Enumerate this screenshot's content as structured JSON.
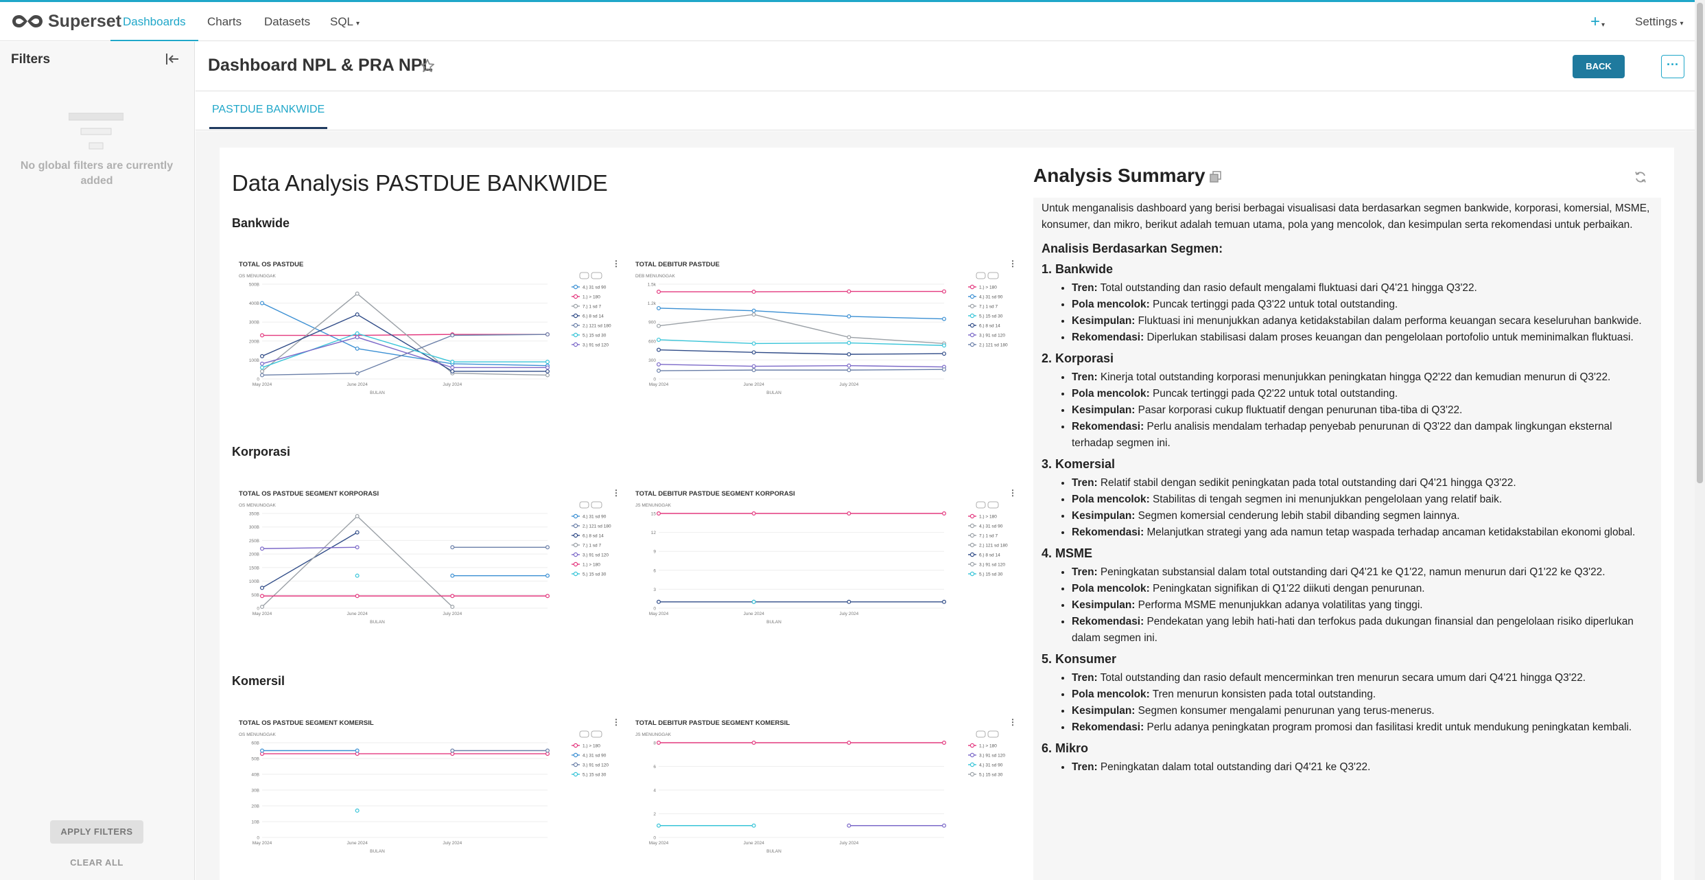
{
  "app": {
    "brand": "Superset"
  },
  "nav": {
    "items": [
      {
        "label": "Dashboards",
        "active": true
      },
      {
        "label": "Charts"
      },
      {
        "label": "Datasets"
      },
      {
        "label": "SQL"
      }
    ],
    "plus": "+",
    "settings": "Settings"
  },
  "sidebar": {
    "title": "Filters",
    "empty_text": "No global filters are currently added",
    "apply_label": "APPLY FILTERS",
    "clear_label": "CLEAR ALL"
  },
  "dashboard": {
    "title": "Dashboard NPL & PRA NPL",
    "back_label": "BACK",
    "more_label": "···",
    "tab": "PASTDUE BANKWIDE",
    "heading": "Data Analysis PASTDUE BANKWIDE",
    "sections": [
      "Bankwide",
      "Korporasi",
      "Komersil"
    ]
  },
  "colors": {
    "accent": "#20a7c9",
    "pink": "#e3387e",
    "navy": "#2f4b87",
    "teal": "#37c4d8",
    "grey": "#9aa0a6",
    "blue": "#3a8fd3",
    "purple": "#7b68c8"
  },
  "chart_data": [
    {
      "title": "TOTAL OS PASTDUE",
      "type": "line",
      "ylabel": "OS MENUNGGAK",
      "xlabel": "BULAN",
      "x": [
        "May 2024",
        "June 2024",
        "July 2024",
        ""
      ],
      "yticks": [
        "0",
        "100B",
        "200B",
        "300B",
        "400B",
        "500B"
      ],
      "ylim": [
        0,
        500
      ],
      "legend": [
        "4.) 31 sd 90",
        "1.) > 180",
        "7.) 1 sd 7",
        "6.) 8 sd 14",
        "2.) 121 sd 180",
        "5.) 15 sd 30",
        "3.) 91 sd 120"
      ],
      "series": [
        {
          "name": "4.) 31 sd 90",
          "color": "#3a8fd3",
          "values": [
            400,
            160,
            80,
            70
          ]
        },
        {
          "name": "1.) > 180",
          "color": "#e3387e",
          "values": [
            230,
            230,
            235,
            235
          ]
        },
        {
          "name": "7.) 1 sd 7",
          "color": "#9aa0a6",
          "values": [
            40,
            450,
            30,
            20
          ]
        },
        {
          "name": "6.) 8 sd 14",
          "color": "#2f4b87",
          "values": [
            120,
            340,
            40,
            40
          ]
        },
        {
          "name": "2.) 121 sd 180",
          "color": "#6a7fa8",
          "values": [
            20,
            30,
            230,
            235
          ]
        },
        {
          "name": "5.) 15 sd 30",
          "color": "#37c4d8",
          "values": [
            60,
            240,
            90,
            90
          ]
        },
        {
          "name": "3.) 91 sd 120",
          "color": "#7b68c8",
          "values": [
            80,
            220,
            60,
            60
          ]
        }
      ]
    },
    {
      "title": "TOTAL DEBITUR PASTDUE",
      "type": "line",
      "ylabel": "DEB MENUNGGAK",
      "xlabel": "BULAN",
      "x": [
        "May 2024",
        "June 2024",
        "July 2024",
        ""
      ],
      "yticks": [
        "0",
        "300",
        "600",
        "900",
        "1.2k",
        "1.5k"
      ],
      "ylim": [
        0,
        1500
      ],
      "legend": [
        "1.) > 180",
        "4.) 31 sd 90",
        "7.) 1 sd 7",
        "5.) 15 sd 30",
        "6.) 8 sd 14",
        "3.) 91 sd 120",
        "2.) 121 sd 180"
      ],
      "series": [
        {
          "name": "1.) > 180",
          "color": "#e3387e",
          "values": [
            1380,
            1380,
            1385,
            1385
          ]
        },
        {
          "name": "4.) 31 sd 90",
          "color": "#3a8fd3",
          "values": [
            1120,
            1080,
            990,
            950
          ]
        },
        {
          "name": "7.) 1 sd 7",
          "color": "#9aa0a6",
          "values": [
            840,
            1020,
            660,
            560
          ]
        },
        {
          "name": "5.) 15 sd 30",
          "color": "#37c4d8",
          "values": [
            620,
            560,
            570,
            530
          ]
        },
        {
          "name": "6.) 8 sd 14",
          "color": "#2f4b87",
          "values": [
            460,
            420,
            390,
            400
          ]
        },
        {
          "name": "3.) 91 sd 120",
          "color": "#7b68c8",
          "values": [
            230,
            200,
            210,
            190
          ]
        },
        {
          "name": "2.) 121 sd 180",
          "color": "#6a7fa8",
          "values": [
            130,
            140,
            140,
            150
          ]
        }
      ]
    },
    {
      "title": "TOTAL OS PASTDUE SEGMENT KORPORASI",
      "type": "line",
      "ylabel": "OS MENUNGGAK",
      "xlabel": "BULAN",
      "x": [
        "May 2024",
        "June 2024",
        "July 2024",
        ""
      ],
      "yticks": [
        "0",
        "50B",
        "100B",
        "150B",
        "200B",
        "250B",
        "300B",
        "350B"
      ],
      "ylim": [
        0,
        350
      ],
      "legend": [
        "4.) 31 sd 90",
        "2.) 121 sd 180",
        "6.) 8 sd 14",
        "7.) 1 sd 7",
        "3.) 91 sd 120",
        "1.) > 180",
        "5.) 15 sd 30"
      ],
      "series": [
        {
          "name": "4.) 31 sd 90",
          "color": "#3a8fd3",
          "values": [
            null,
            null,
            120,
            120
          ]
        },
        {
          "name": "2.) 121 sd 180",
          "color": "#6a7fa8",
          "values": [
            null,
            null,
            225,
            225
          ]
        },
        {
          "name": "6.) 8 sd 14",
          "color": "#2f4b87",
          "values": [
            75,
            280,
            null,
            null
          ]
        },
        {
          "name": "7.) 1 sd 7",
          "color": "#9aa0a6",
          "values": [
            5,
            340,
            5,
            null
          ]
        },
        {
          "name": "3.) 91 sd 120",
          "color": "#7b68c8",
          "values": [
            220,
            225,
            null,
            null
          ]
        },
        {
          "name": "1.) > 180",
          "color": "#e3387e",
          "values": [
            45,
            45,
            45,
            45
          ]
        },
        {
          "name": "5.) 15 sd 30",
          "color": "#37c4d8",
          "values": [
            null,
            120,
            null,
            null
          ]
        }
      ]
    },
    {
      "title": "TOTAL DEBITUR PASTDUE SEGMENT KORPORASI",
      "type": "line",
      "ylabel": "JS MENUNGGAK",
      "xlabel": "BULAN",
      "x": [
        "May 2024",
        "June 2024",
        "July 2024",
        ""
      ],
      "yticks": [
        "0",
        "3",
        "6",
        "9",
        "12",
        "15"
      ],
      "ylim": [
        0,
        15
      ],
      "legend": [
        "1.) > 180",
        "4.) 31 sd 90",
        "7.) 1 sd 7",
        "2.) 121 sd 180",
        "6.) 8 sd 14",
        "3.) 91 sd 120",
        "5.) 15 sd 30"
      ],
      "series": [
        {
          "name": "1.) > 180",
          "color": "#e3387e",
          "values": [
            15,
            15,
            15,
            15
          ]
        },
        {
          "name": "6.) 8 sd 14",
          "color": "#2f4b87",
          "values": [
            1,
            1,
            1,
            1
          ]
        },
        {
          "name": "5.) 15 sd 30",
          "color": "#37c4d8",
          "values": [
            null,
            1,
            null,
            null
          ]
        }
      ]
    },
    {
      "title": "TOTAL OS PASTDUE SEGMENT KOMERSIL",
      "type": "line",
      "ylabel": "OS MENUNGGAK",
      "xlabel": "BULAN",
      "x": [
        "May 2024",
        "June 2024",
        "July 2024",
        ""
      ],
      "yticks": [
        "0",
        "10B",
        "20B",
        "30B",
        "40B",
        "50B",
        "60B"
      ],
      "ylim": [
        0,
        60
      ],
      "legend": [
        "1.) > 180",
        "4.) 31 sd 90",
        "3.) 91 sd 120",
        "5.) 15 sd 30"
      ],
      "series": [
        {
          "name": "1.) > 180",
          "color": "#e3387e",
          "values": [
            53,
            53,
            53,
            53
          ]
        },
        {
          "name": "4.) 31 sd 90",
          "color": "#3a8fd3",
          "values": [
            55,
            55,
            null,
            null
          ]
        },
        {
          "name": "3.) 91 sd 120",
          "color": "#6a7fa8",
          "values": [
            null,
            null,
            55,
            55
          ]
        },
        {
          "name": "5.) 15 sd 30",
          "color": "#37c4d8",
          "values": [
            null,
            17,
            null,
            null
          ]
        }
      ]
    },
    {
      "title": "TOTAL DEBITUR PASTDUE SEGMENT KOMERSIL",
      "type": "line",
      "ylabel": "JS MENUNGGAK",
      "xlabel": "BULAN",
      "x": [
        "May 2024",
        "June 2024",
        "July 2024",
        ""
      ],
      "yticks": [
        "0",
        "2",
        "4",
        "6",
        "8"
      ],
      "ylim": [
        0,
        8
      ],
      "legend": [
        "1.) > 180",
        "3.) 91 sd 120",
        "4.) 31 sd 90",
        "5.) 15 sd 30"
      ],
      "series": [
        {
          "name": "1.) > 180",
          "color": "#e3387e",
          "values": [
            8,
            8,
            8,
            8
          ]
        },
        {
          "name": "4.) 31 sd 90",
          "color": "#37c4d8",
          "values": [
            1,
            1,
            null,
            null
          ]
        },
        {
          "name": "3.) 91 sd 120",
          "color": "#7b68c8",
          "values": [
            null,
            null,
            1,
            1
          ]
        }
      ]
    }
  ],
  "summary": {
    "title": "Analysis Summary",
    "intro": "Untuk menganalisis dashboard yang berisi berbagai visualisasi data berdasarkan segmen bankwide, korporasi, komersial, MSME, konsumer, dan mikro, berikut adalah temuan utama, pola yang mencolok, dan kesimpulan serta rekomendasi untuk perbaikan.",
    "heading": "Analisis Berdasarkan Segmen:",
    "segments": [
      {
        "title": "1. Bankwide",
        "points": [
          {
            "k": "Tren:",
            "v": " Total outstanding dan rasio default mengalami fluktuasi dari Q4'21 hingga Q3'22."
          },
          {
            "k": "Pola mencolok:",
            "v": " Puncak tertinggi pada Q3'22 untuk total outstanding."
          },
          {
            "k": "Kesimpulan:",
            "v": " Fluktuasi ini menunjukkan adanya ketidakstabilan dalam performa keuangan secara keseluruhan bankwide."
          },
          {
            "k": "Rekomendasi:",
            "v": " Diperlukan stabilisasi dalam proses keuangan dan pengelolaan portofolio untuk meminimalkan fluktuasi."
          }
        ]
      },
      {
        "title": "2. Korporasi",
        "points": [
          {
            "k": "Tren:",
            "v": " Kinerja total outstanding korporasi menunjukkan peningkatan hingga Q2'22 dan kemudian menurun di Q3'22."
          },
          {
            "k": "Pola mencolok:",
            "v": " Puncak tertinggi pada Q2'22 untuk total outstanding."
          },
          {
            "k": "Kesimpulan:",
            "v": " Pasar korporasi cukup fluktuatif dengan penurunan tiba-tiba di Q3'22."
          },
          {
            "k": "Rekomendasi:",
            "v": " Perlu analisis mendalam terhadap penyebab penurunan di Q3'22 dan dampak lingkungan eksternal terhadap segmen ini."
          }
        ]
      },
      {
        "title": "3. Komersial",
        "points": [
          {
            "k": "Tren:",
            "v": " Relatif stabil dengan sedikit peningkatan pada total outstanding dari Q4'21 hingga Q3'22."
          },
          {
            "k": "Pola mencolok:",
            "v": " Stabilitas di tengah segmen ini menunjukkan pengelolaan yang relatif baik."
          },
          {
            "k": "Kesimpulan:",
            "v": " Segmen komersial cenderung lebih stabil dibanding segmen lainnya."
          },
          {
            "k": "Rekomendasi:",
            "v": " Melanjutkan strategi yang ada namun tetap waspada terhadap ancaman ketidakstabilan ekonomi global."
          }
        ]
      },
      {
        "title": "4. MSME",
        "points": [
          {
            "k": "Tren:",
            "v": " Peningkatan substansial dalam total outstanding dari Q4'21 ke Q1'22, namun menurun dari Q1'22 ke Q3'22."
          },
          {
            "k": "Pola mencolok:",
            "v": " Peningkatan signifikan di Q1'22 diikuti dengan penurunan."
          },
          {
            "k": "Kesimpulan:",
            "v": " Performa MSME menunjukkan adanya volatilitas yang tinggi."
          },
          {
            "k": "Rekomendasi:",
            "v": " Pendekatan yang lebih hati-hati dan terfokus pada dukungan finansial dan pengelolaan risiko diperlukan dalam segmen ini."
          }
        ]
      },
      {
        "title": "5. Konsumer",
        "points": [
          {
            "k": "Tren:",
            "v": " Total outstanding dan rasio default mencerminkan tren menurun secara umum dari Q4'21 hingga Q3'22."
          },
          {
            "k": "Pola mencolok:",
            "v": " Tren menurun konsisten pada total outstanding."
          },
          {
            "k": "Kesimpulan:",
            "v": " Segmen konsumer mengalami penurunan yang terus-menerus."
          },
          {
            "k": "Rekomendasi:",
            "v": " Perlu adanya peningkatan program promosi dan fasilitasi kredit untuk mendukung peningkatan kembali."
          }
        ]
      },
      {
        "title": "6. Mikro",
        "points": [
          {
            "k": "Tren:",
            "v": " Peningkatan dalam total outstanding dari Q4'21 ke Q3'22."
          }
        ]
      }
    ]
  }
}
